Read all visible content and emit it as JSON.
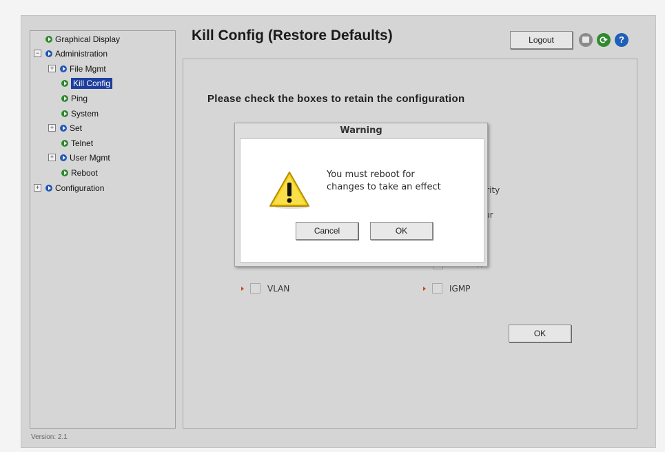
{
  "sidebar": {
    "items": [
      {
        "label": "Graphical Display",
        "icon": "green-arrow-icon",
        "expander": ""
      },
      {
        "label": "Administration",
        "icon": "blue-arrow-icon",
        "expander": "−"
      },
      {
        "label": "File Mgmt",
        "icon": "blue-arrow-icon",
        "expander": "+"
      },
      {
        "label": "Kill Config",
        "icon": "green-arrow-icon",
        "expander": "",
        "selected": true
      },
      {
        "label": "Ping",
        "icon": "green-arrow-icon",
        "expander": ""
      },
      {
        "label": "System",
        "icon": "green-arrow-icon",
        "expander": ""
      },
      {
        "label": "Set",
        "icon": "blue-arrow-icon",
        "expander": "+"
      },
      {
        "label": "Telnet",
        "icon": "green-arrow-icon",
        "expander": ""
      },
      {
        "label": "User Mgmt",
        "icon": "blue-arrow-icon",
        "expander": "+"
      },
      {
        "label": "Reboot",
        "icon": "green-arrow-icon",
        "expander": ""
      },
      {
        "label": "Configuration",
        "icon": "blue-arrow-icon",
        "expander": "+"
      }
    ],
    "version": "Version: 2.1"
  },
  "header": {
    "title": "Kill Config (Restore Defaults)",
    "logout_label": "Logout",
    "icons": [
      "save-icon",
      "refresh-icon",
      "help-icon"
    ]
  },
  "main": {
    "instruction": "Please check the boxes to retain the configuration",
    "options": [
      {
        "label": "curity",
        "checked": false
      },
      {
        "label": "rror",
        "checked": false
      },
      {
        "label": "TP",
        "checked": false
      },
      {
        "label": "VLAN",
        "checked": false
      },
      {
        "label": "IGMP",
        "checked": false
      }
    ],
    "ok_label": "OK"
  },
  "dialog": {
    "title": "Warning",
    "message_line1": "You must reboot for",
    "message_line2": "changes to take an effect",
    "cancel_label": "Cancel",
    "ok_label": "OK",
    "icon": "warning-icon"
  },
  "colors": {
    "selected_bg": "#1d3e9c",
    "green_icon": "#2e8a2e",
    "blue_icon": "#1f56b8",
    "arrow": "#c04a16"
  }
}
